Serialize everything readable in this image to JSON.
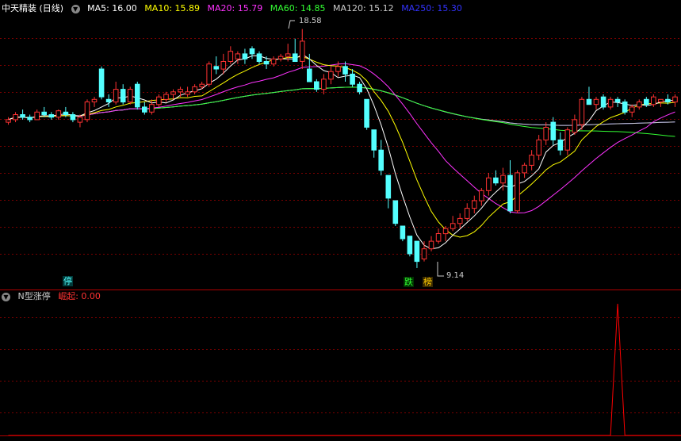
{
  "header": {
    "title": "中天精装 (日线)",
    "ma": [
      {
        "label": "MA5: 16.00",
        "color": "#ffffff"
      },
      {
        "label": "MA10: 15.89",
        "color": "#ffff00"
      },
      {
        "label": "MA20: 15.79",
        "color": "#ff33ff"
      },
      {
        "label": "MA60: 14.85",
        "color": "#33ff33"
      },
      {
        "label": "MA120: 15.12",
        "color": "#cccccc"
      },
      {
        "label": "MA250: 15.30",
        "color": "#3333ff"
      }
    ]
  },
  "annotations": {
    "high_label": "18.58",
    "low_label": "9.14",
    "tag_ting": "停",
    "tag_die": "跌",
    "tag_bang": "榜"
  },
  "indicator": {
    "name": "N型涨停",
    "series_label": "崛起: 0.00"
  },
  "colors": {
    "up": "#ff3232",
    "down": "#54ffff",
    "grid": "#7a0000",
    "ma5": "#ffffff",
    "ma10": "#ffff00",
    "ma20": "#ff33ff",
    "ma60": "#33ff33",
    "ma120": "#cccccc",
    "ma250": "#3333ff",
    "indicator": "#ff0000"
  },
  "chart_data": {
    "type": "candlestick",
    "candles": [
      [
        14.9,
        15.1,
        14.8,
        15.0
      ],
      [
        15.0,
        15.3,
        14.9,
        15.2
      ],
      [
        15.2,
        15.4,
        15.0,
        15.1
      ],
      [
        15.1,
        15.2,
        14.9,
        15.0
      ],
      [
        15.0,
        15.4,
        15.0,
        15.3
      ],
      [
        15.3,
        15.5,
        15.1,
        15.2
      ],
      [
        15.2,
        15.3,
        15.0,
        15.1
      ],
      [
        15.1,
        15.4,
        15.0,
        15.35
      ],
      [
        15.3,
        15.5,
        15.1,
        15.2
      ],
      [
        15.2,
        15.3,
        14.9,
        15.0
      ],
      [
        14.9,
        15.2,
        14.7,
        15.1
      ],
      [
        15.0,
        15.8,
        14.9,
        15.7
      ],
      [
        15.7,
        15.9,
        15.5,
        15.8
      ],
      [
        17.0,
        17.1,
        15.8,
        15.9
      ],
      [
        15.8,
        16.0,
        15.5,
        15.7
      ],
      [
        15.7,
        16.5,
        15.6,
        16.2
      ],
      [
        16.2,
        16.4,
        15.6,
        15.7
      ],
      [
        15.7,
        16.3,
        15.6,
        16.2
      ],
      [
        16.4,
        16.5,
        15.4,
        15.5
      ],
      [
        15.5,
        15.7,
        15.2,
        15.3
      ],
      [
        15.3,
        15.8,
        15.2,
        15.6
      ],
      [
        15.6,
        16.0,
        15.5,
        15.9
      ],
      [
        15.8,
        16.1,
        15.7,
        16.0
      ],
      [
        16.0,
        16.2,
        15.8,
        16.1
      ],
      [
        16.1,
        16.3,
        15.9,
        16.2
      ],
      [
        16.0,
        16.3,
        15.9,
        16.1
      ],
      [
        16.1,
        16.4,
        16.0,
        16.3
      ],
      [
        16.3,
        16.5,
        16.2,
        16.4
      ],
      [
        16.4,
        17.3,
        16.3,
        17.2
      ],
      [
        17.1,
        17.5,
        16.8,
        17.0
      ],
      [
        17.0,
        17.6,
        16.8,
        17.3
      ],
      [
        17.3,
        17.9,
        17.2,
        17.7
      ],
      [
        17.4,
        17.7,
        17.2,
        17.6
      ],
      [
        17.6,
        17.8,
        17.2,
        17.4
      ],
      [
        17.8,
        17.9,
        17.4,
        17.6
      ],
      [
        17.6,
        17.7,
        17.2,
        17.3
      ],
      [
        17.3,
        17.5,
        17.0,
        17.2
      ],
      [
        17.2,
        17.5,
        17.1,
        17.4
      ],
      [
        17.4,
        17.6,
        17.3,
        17.5
      ],
      [
        17.5,
        18.0,
        17.3,
        17.6
      ],
      [
        17.6,
        18.2,
        17.4,
        17.3
      ],
      [
        17.3,
        18.58,
        17.0,
        18.1
      ],
      [
        17.0,
        17.6,
        16.5,
        16.5
      ],
      [
        16.5,
        16.6,
        16.1,
        16.2
      ],
      [
        16.2,
        16.8,
        16.0,
        16.6
      ],
      [
        16.6,
        17.1,
        16.4,
        16.9
      ],
      [
        16.9,
        17.3,
        16.7,
        17.1
      ],
      [
        17.1,
        17.3,
        16.5,
        16.8
      ],
      [
        16.8,
        17.0,
        16.3,
        16.4
      ],
      [
        16.4,
        16.5,
        16.0,
        16.1
      ],
      [
        15.8,
        15.8,
        14.6,
        14.7
      ],
      [
        14.6,
        14.6,
        13.5,
        13.8
      ],
      [
        13.8,
        14.2,
        12.8,
        13.0
      ],
      [
        12.8,
        12.8,
        11.5,
        11.9
      ],
      [
        11.8,
        11.8,
        10.8,
        10.9
      ],
      [
        10.8,
        10.8,
        10.2,
        10.3
      ],
      [
        10.4,
        10.4,
        9.6,
        9.7
      ],
      [
        10.2,
        10.2,
        9.14,
        9.4
      ],
      [
        9.5,
        10.2,
        9.4,
        9.9
      ],
      [
        9.9,
        10.4,
        9.8,
        10.2
      ],
      [
        10.2,
        10.7,
        10.1,
        10.5
      ],
      [
        10.5,
        10.8,
        10.2,
        10.7
      ],
      [
        10.7,
        11.2,
        10.6,
        10.9
      ],
      [
        10.9,
        11.3,
        10.7,
        11.1
      ],
      [
        11.1,
        11.7,
        11.0,
        11.5
      ],
      [
        11.5,
        12.0,
        11.3,
        11.8
      ],
      [
        11.8,
        12.3,
        11.6,
        12.2
      ],
      [
        12.2,
        12.9,
        12.0,
        12.7
      ],
      [
        12.7,
        13.0,
        12.4,
        12.5
      ],
      [
        12.5,
        13.1,
        12.2,
        12.8
      ],
      [
        12.8,
        13.4,
        11.3,
        11.4
      ],
      [
        11.4,
        13.0,
        11.3,
        12.9
      ],
      [
        12.9,
        13.3,
        12.7,
        13.2
      ],
      [
        13.2,
        13.8,
        13.0,
        13.6
      ],
      [
        13.6,
        14.4,
        13.4,
        14.2
      ],
      [
        14.2,
        14.9,
        14.0,
        14.7
      ],
      [
        14.9,
        15.1,
        14.0,
        14.2
      ],
      [
        14.2,
        14.5,
        13.6,
        13.8
      ],
      [
        13.8,
        14.7,
        13.6,
        14.6
      ],
      [
        14.5,
        15.2,
        14.4,
        15.0
      ],
      [
        14.8,
        15.9,
        14.6,
        15.8
      ],
      [
        15.8,
        16.3,
        15.6,
        15.6
      ],
      [
        15.6,
        15.9,
        15.4,
        15.8
      ],
      [
        15.9,
        16.0,
        15.4,
        15.5
      ],
      [
        15.5,
        15.9,
        15.4,
        15.8
      ],
      [
        15.8,
        15.9,
        15.5,
        15.7
      ],
      [
        15.7,
        15.8,
        15.2,
        15.3
      ],
      [
        15.3,
        15.6,
        15.1,
        15.5
      ],
      [
        15.5,
        15.8,
        15.4,
        15.7
      ],
      [
        15.8,
        15.9,
        15.5,
        15.6
      ],
      [
        15.6,
        16.0,
        15.5,
        15.9
      ],
      [
        15.7,
        15.8,
        15.5,
        15.8
      ],
      [
        15.8,
        16.0,
        15.6,
        15.7
      ],
      [
        15.7,
        16.0,
        15.5,
        15.9
      ]
    ],
    "indicator_values": [
      0,
      0,
      0,
      0,
      0,
      0,
      0,
      0,
      0,
      0,
      0,
      0,
      0,
      0,
      0,
      0,
      0,
      0,
      0,
      0,
      0,
      0,
      0,
      0,
      0,
      0,
      0,
      0,
      0,
      0,
      0,
      0,
      0,
      0,
      0,
      0,
      0,
      0,
      0,
      0,
      0,
      0,
      0,
      0,
      0,
      0,
      0,
      0,
      0,
      0,
      0,
      0,
      0,
      0,
      0,
      0,
      0,
      0,
      0,
      0,
      0,
      0,
      0,
      0,
      0,
      0,
      0,
      0,
      0,
      0,
      0,
      0,
      0,
      0,
      0,
      0,
      0,
      0,
      0,
      0,
      0,
      0,
      0,
      0,
      0,
      1,
      0,
      0,
      0,
      0,
      0,
      0,
      0,
      0,
      0,
      0,
      0,
      0,
      0,
      0
    ]
  }
}
